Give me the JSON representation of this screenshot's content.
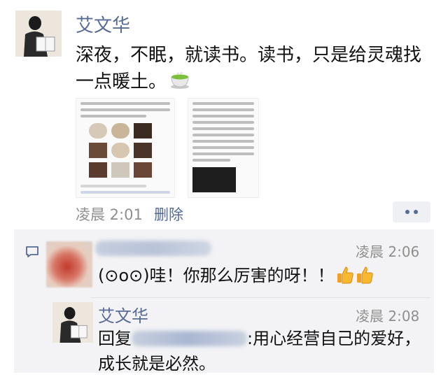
{
  "post": {
    "author": "艾文华",
    "text": "深夜，不眠，就读书。读书，只是给灵魂找一点暖土。",
    "emoji_icon": "teacup-icon",
    "time": "凌晨 2:01",
    "delete_label": "删除"
  },
  "comments": [
    {
      "author_visible": false,
      "time": "凌晨 2:06",
      "text": "(⊙o⊙)哇！你那么厉害的呀！！",
      "emoji_icons": [
        "thumbs-up-icon",
        "thumbs-up-icon"
      ]
    },
    {
      "author": "艾文华",
      "time": "凌晨 2:08",
      "reply_prefix": "回复",
      "text": ":用心经营自己的爱好，成长就是必然。"
    }
  ],
  "colors": {
    "link": "#576b95",
    "muted": "#8f8f8f",
    "comments_bg": "#f3f3f5"
  }
}
